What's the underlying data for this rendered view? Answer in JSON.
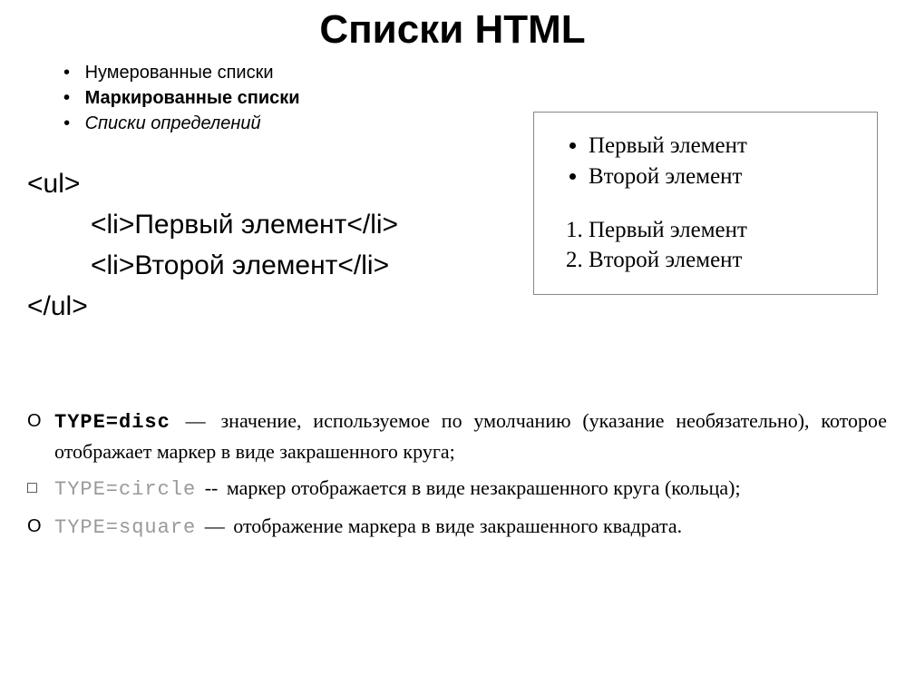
{
  "title": "Списки HTML",
  "types": {
    "item1": "Нумерованные списки",
    "item2": "Маркированные списки",
    "item3": "Списки определений"
  },
  "code": {
    "open": "<ul>",
    "li1": "<li>Первый элемент</li>",
    "li2": "<li>Второй элемент</li>",
    "close": "</ul>"
  },
  "output": {
    "ul1": "Первый элемент",
    "ul2": "Второй элемент",
    "ol1": "Первый элемент",
    "ol2": "Второй элемент"
  },
  "defs": {
    "disc": {
      "marker": "O",
      "kw": "TYPE=disc",
      "dash": "—",
      "text": "значение, используемое по умолчанию (указание необязательно), которое отображает маркер в виде закрашенного круга;"
    },
    "circle": {
      "marker": "□",
      "kw": "TYPE=circle",
      "dash": "--",
      "text": "маркер отображается в виде незакрашенного круга (кольца);"
    },
    "square": {
      "marker": "O",
      "kw": "TYPE=square",
      "dash": "—",
      "text": "отображение маркера в виде закрашенного квадрата."
    }
  }
}
